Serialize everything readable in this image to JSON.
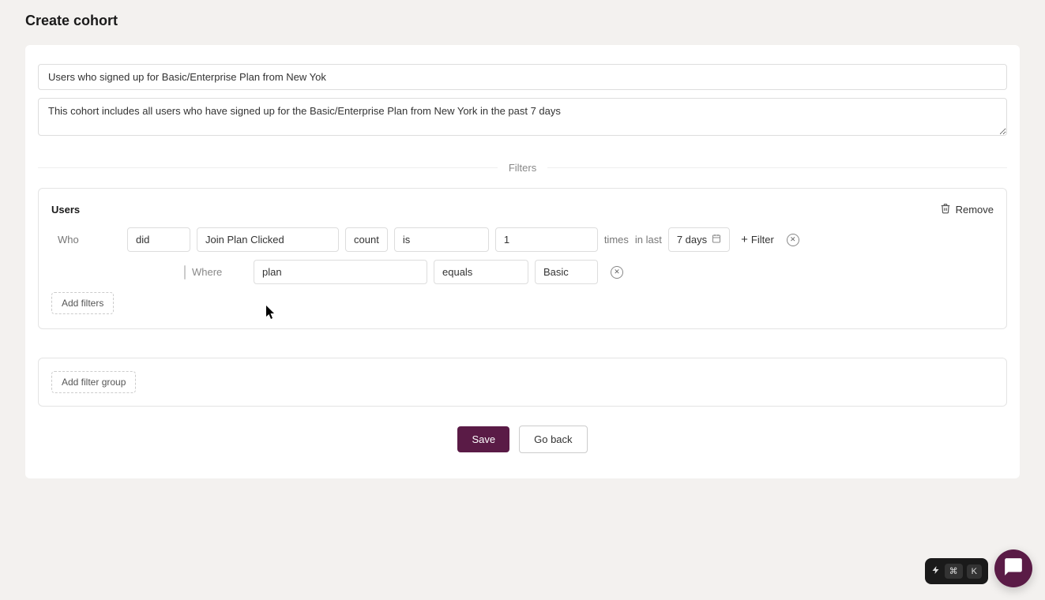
{
  "page": {
    "title": "Create cohort"
  },
  "form": {
    "name_value": "Users who signed up for Basic/Enterprise Plan from New Yok",
    "description_value": "This cohort includes all users who have signed up for the Basic/Enterprise Plan from New York in the past 7 days"
  },
  "filters_section_label": "Filters",
  "filter_group": {
    "title": "Users",
    "remove_label": "Remove",
    "row": {
      "who_label": "Who",
      "did_value": "did",
      "event_value": "Join Plan Clicked",
      "count_label": "count",
      "operator_value": "is",
      "number_value": "1",
      "times_label": "times",
      "in_last_label": "in last",
      "timerange_value": "7 days",
      "filter_link_label": "Filter"
    },
    "subrow": {
      "where_label": "Where",
      "property_value": "plan",
      "operator_value": "equals",
      "value_value": "Basic"
    },
    "add_filters_label": "Add filters"
  },
  "add_filter_group_label": "Add filter group",
  "actions": {
    "save_label": "Save",
    "goback_label": "Go back"
  },
  "shortcut": {
    "cmd_key": "⌘",
    "k_key": "K"
  }
}
